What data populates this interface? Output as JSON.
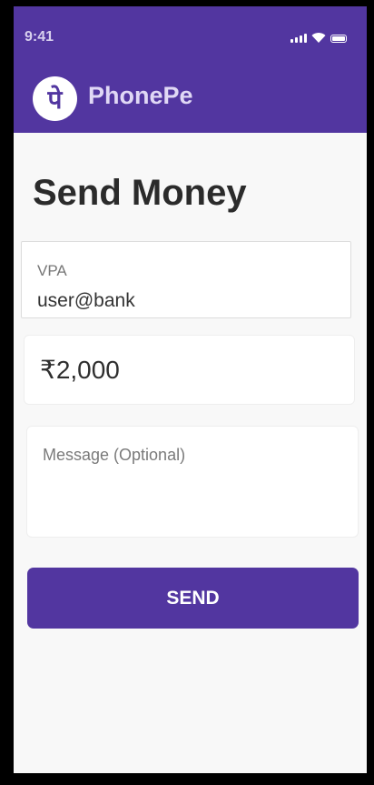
{
  "status_bar": {
    "time": "9:41"
  },
  "header": {
    "logo_text": "पे",
    "brand": "PhonePe"
  },
  "page": {
    "title": "Send Money"
  },
  "form": {
    "vpa_label": "VPA",
    "vpa_value": "user@bank",
    "amount_value": "₹2,000",
    "message_placeholder": "Message (Optional)",
    "send_label": "SEND"
  },
  "colors": {
    "brand": "#5236a0",
    "background": "#f8f8f8"
  }
}
